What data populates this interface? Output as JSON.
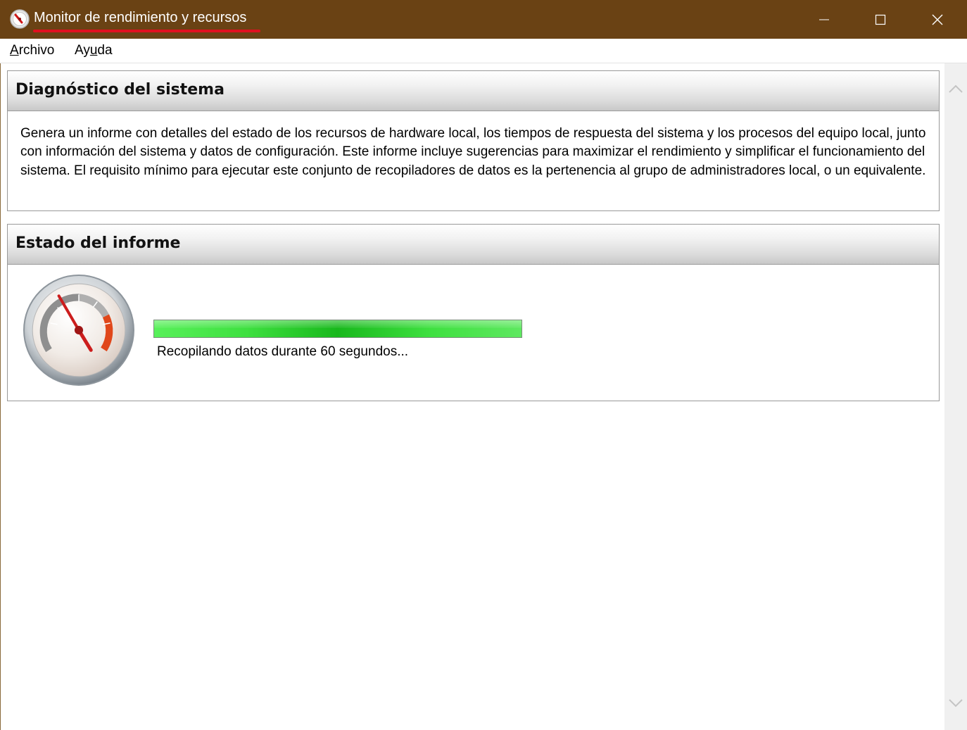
{
  "window": {
    "title": "Monitor de rendimiento y recursos",
    "controls": {
      "minimize": "minimize",
      "maximize": "maximize",
      "close": "close"
    },
    "titlebar_color": "#6a4214",
    "title_highlight_color": "#e0101f"
  },
  "menu": {
    "archivo": {
      "first": "A",
      "rest": "rchivo"
    },
    "ayuda": {
      "start": "Ay",
      "mnemonic": "u",
      "end": "da"
    }
  },
  "diagnostico": {
    "title": "Diagnóstico del sistema",
    "description": "Genera un informe con detalles del estado de los recursos de hardware local, los tiempos de respuesta del sistema y los procesos del equipo local, junto con información del sistema y datos de configuración. Este informe incluye sugerencias para maximizar el rendimiento y simplificar el funcionamiento del sistema. El requisito mínimo para ejecutar este conjunto de recopiladores de datos es la pertenencia al grupo de administradores local, o un equivalente."
  },
  "estado": {
    "title": "Estado del informe",
    "icon": "performance-gauge-icon",
    "progress_percent": 100,
    "status_text": "Recopilando datos durante 60 segundos..."
  },
  "colors": {
    "progress_green": "#3ee040",
    "progress_dark_green": "#18b81c"
  }
}
